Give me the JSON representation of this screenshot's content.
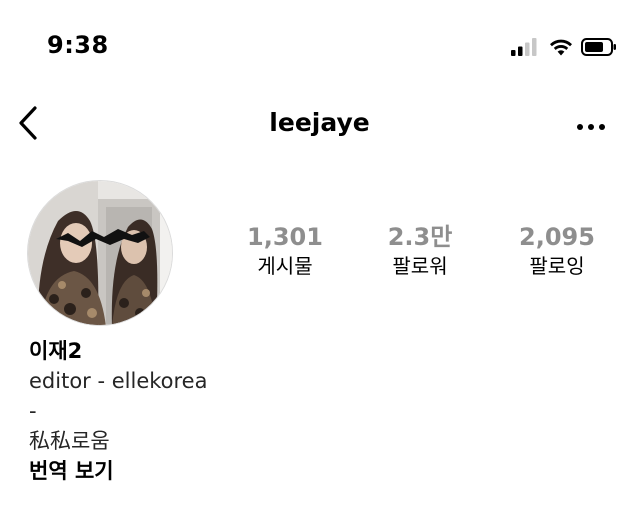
{
  "status_bar": {
    "time": "9:38"
  },
  "header": {
    "username": "leejaye",
    "back_icon": "chevron-left-icon",
    "more_icon": "ellipsis-horizontal-icon"
  },
  "profile": {
    "stats": [
      {
        "count": "1,301",
        "label": "게시물"
      },
      {
        "count": "2.3만",
        "label": "팔로워"
      },
      {
        "count": "2,095",
        "label": "팔로잉"
      }
    ],
    "display_name": "이재2",
    "bio_lines": [
      "editor - ellekorea",
      "-",
      "私私로움"
    ],
    "translate_label": "번역 보기"
  },
  "colors": {
    "stat_count": "#8e8e8e",
    "text": "#000000",
    "avatar_border": "#dbdbdb"
  }
}
